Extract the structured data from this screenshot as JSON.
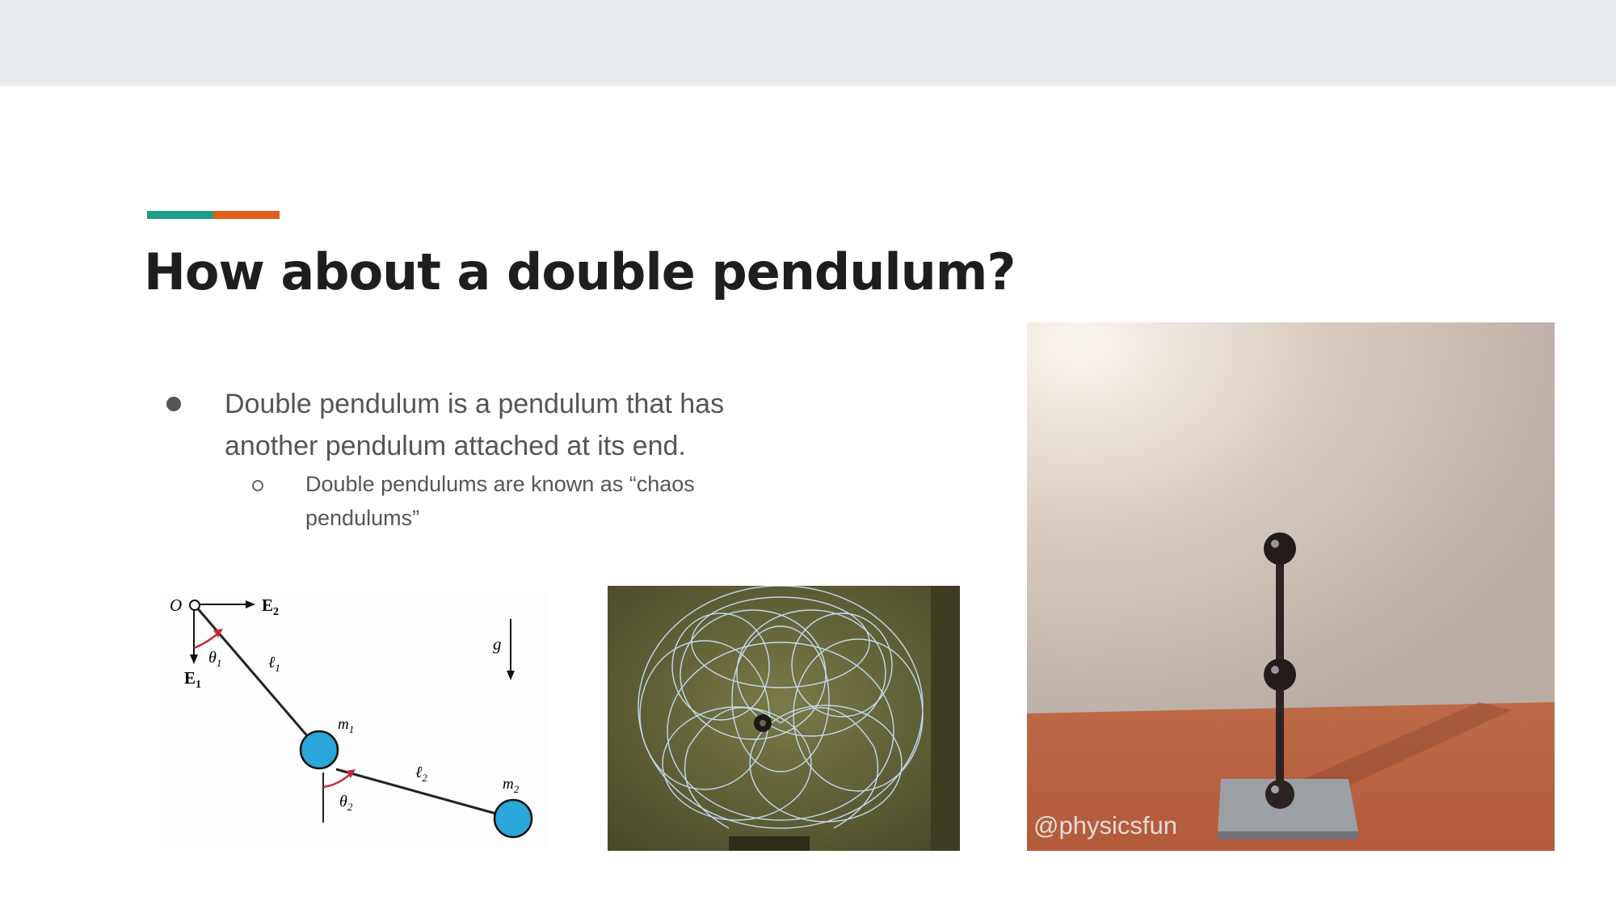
{
  "slide": {
    "title": "How about a double pendulum?",
    "bullets": [
      {
        "text": "Double pendulum is a pendulum that has another pendulum attached at its end.",
        "sub_bullets": [
          {
            "text": "Double pendulums are known as “chaos pendulums”"
          }
        ]
      }
    ]
  },
  "diagram": {
    "labels": {
      "origin": "O",
      "e2": "E",
      "e2_sub": "2",
      "e1": "E",
      "e1_sub": "1",
      "theta1": "θ",
      "theta1_sub": "1",
      "l1": "ℓ",
      "l1_sub": "1",
      "m1": "m",
      "m1_sub": "1",
      "theta2": "θ",
      "theta2_sub": "2",
      "l2": "ℓ",
      "l2_sub": "2",
      "m2": "m",
      "m2_sub": "2",
      "g": "g"
    },
    "colors": {
      "bob": "#2aa7d8",
      "angle_arrow": "#c4283c"
    }
  },
  "photos": {
    "chaos_trace": {
      "icon": "light-trace-photo"
    },
    "double_pendulum": {
      "icon": "double-pendulum-photo",
      "credit": "@physicsfun"
    }
  },
  "theme": {
    "accent_teal": "#1f9c8b",
    "accent_orange": "#e0611a",
    "topbar": "#e8ecee"
  }
}
